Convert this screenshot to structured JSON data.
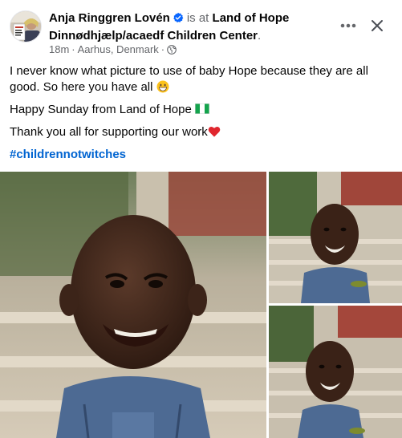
{
  "post": {
    "author": "Anja Ringgren Lovén",
    "location_prefix": "is at",
    "location": "Land of Hope Dinnødhjælp/acaedf Children Center",
    "location_suffix": ".",
    "time": "18m",
    "place": "Aarhus, Denmark",
    "separator": "·",
    "paragraphs": [
      "I never know what picture to use of baby Hope because they are all good. So here you have all",
      "Happy Sunday from Land of Hope",
      "Thank you all for supporting our work"
    ],
    "hashtag": "#childrennotwitches"
  },
  "icons": {
    "verified": "verified-badge-icon",
    "globe": "globe-icon",
    "more": "more-options-icon",
    "close": "close-icon",
    "emoji_grin": "grinning-face-emoji",
    "flag": "nigeria-flag-emoji",
    "heart": "red-heart-emoji"
  },
  "colors": {
    "link": "#0064d1",
    "secondary_text": "#65676b",
    "verified_blue": "#0866ff"
  }
}
